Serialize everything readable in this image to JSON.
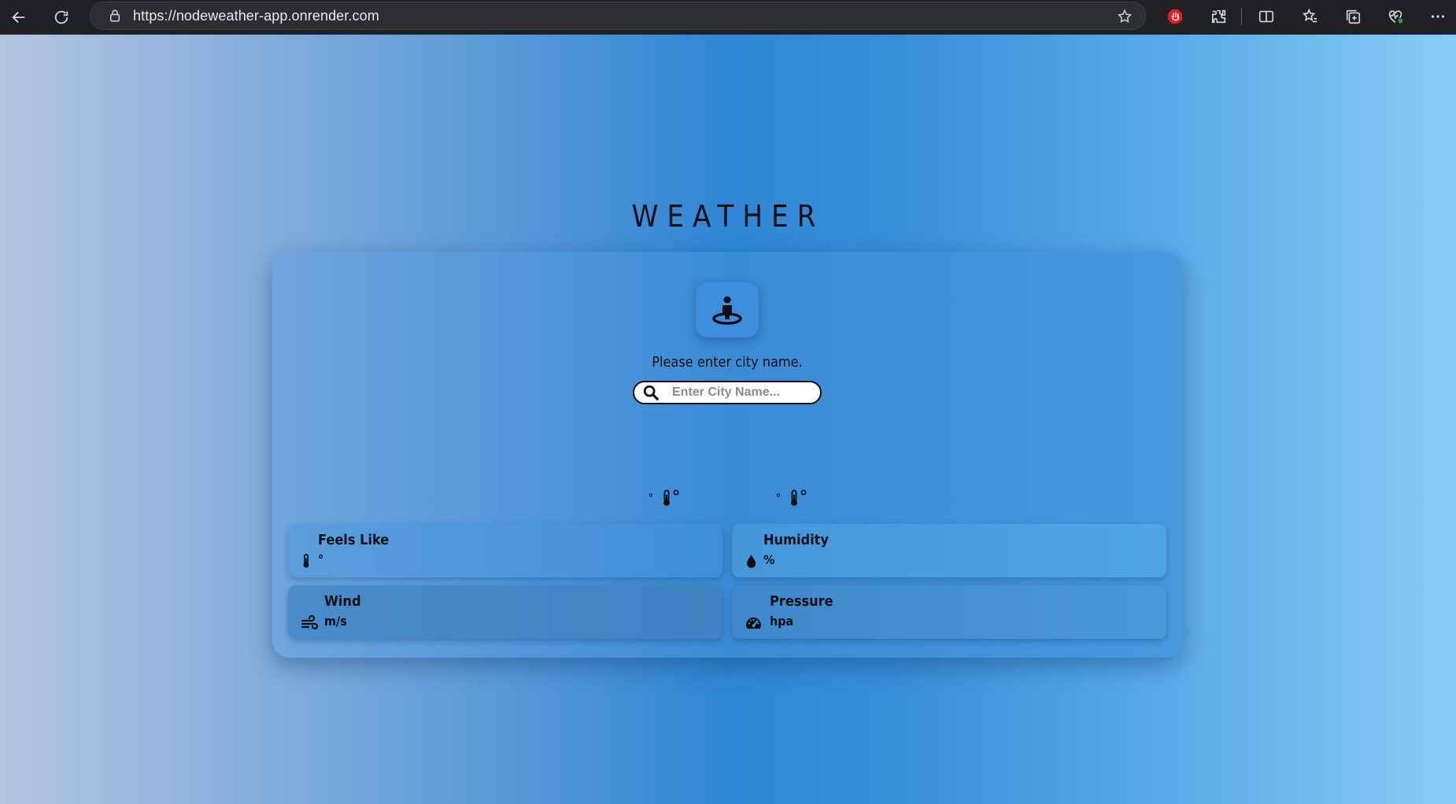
{
  "browser": {
    "url": "https://nodeweather-app.onrender.com"
  },
  "weather": {
    "title": "WEATHER",
    "prompt": "Please enter city name.",
    "search_placeholder": "Enter City Name...",
    "temp_left": {
      "small_degree": "°",
      "big_degree": "°"
    },
    "temp_right": {
      "small_degree": "°",
      "big_degree": "°"
    },
    "tiles": {
      "feels_like": {
        "label": "Feels Like",
        "value": "°"
      },
      "humidity": {
        "label": "Humidity",
        "value": "%"
      },
      "wind": {
        "label": "Wind",
        "value": "m/s"
      },
      "pressure": {
        "label": "Pressure",
        "value": "hpa"
      }
    }
  }
}
